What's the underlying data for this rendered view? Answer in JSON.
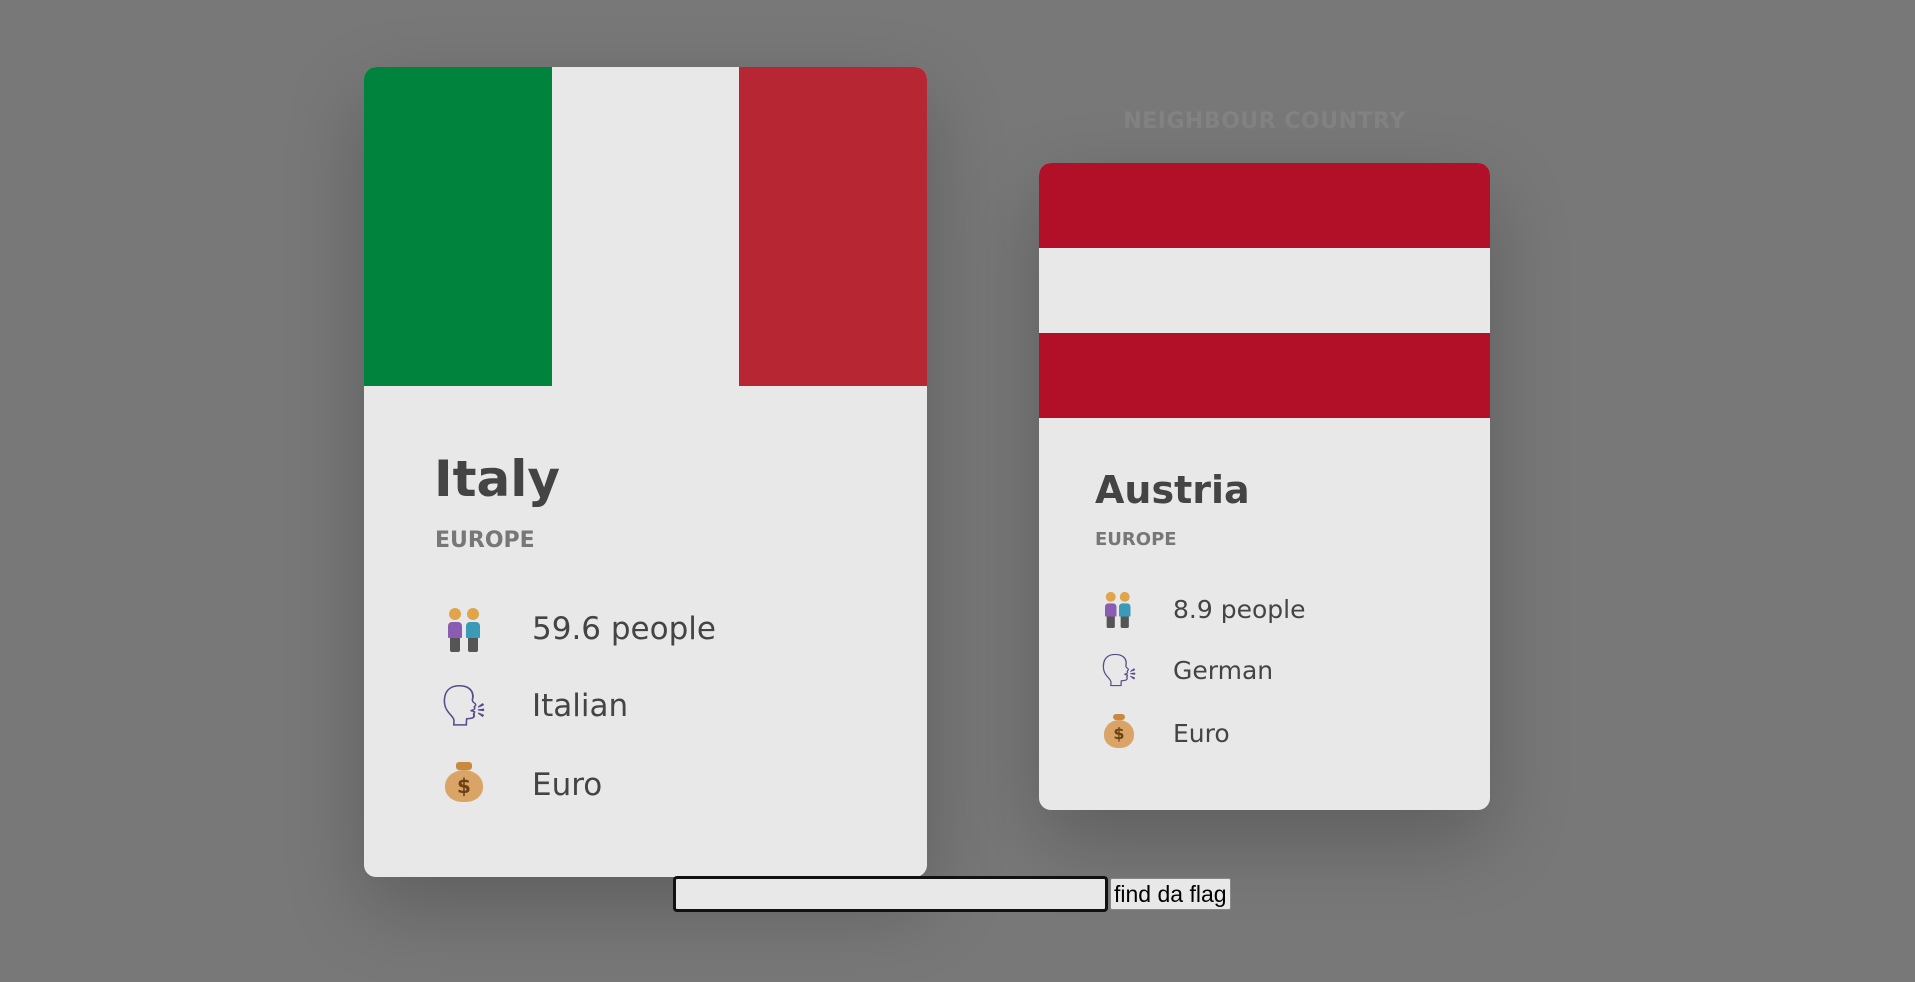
{
  "main_country": {
    "name": "Italy",
    "region": "Europe",
    "flag": {
      "orientation": "vertical",
      "colors": [
        "#00843d",
        "#e8e8e8",
        "#b72733"
      ]
    },
    "population": "59.6 people",
    "language": "Italian",
    "currency": "Euro",
    "icons": {
      "population": "people-icon",
      "language": "speaking-head-icon",
      "currency": "money-bag-icon"
    }
  },
  "neighbour_section": {
    "heading": "Neighbour country"
  },
  "neighbour_country": {
    "name": "Austria",
    "region": "Europe",
    "flag": {
      "orientation": "horizontal",
      "colors": [
        "#b20f28",
        "#e8e8e8",
        "#b20f28"
      ]
    },
    "population": "8.9 people",
    "language": "German",
    "currency": "Euro",
    "icons": {
      "population": "people-icon",
      "language": "speaking-head-icon",
      "currency": "money-bag-icon"
    }
  },
  "search": {
    "input_value": "",
    "button_label": "find da flag"
  },
  "colors": {
    "background": "#787878",
    "card": "#e8e8e8",
    "text": "#444444"
  }
}
